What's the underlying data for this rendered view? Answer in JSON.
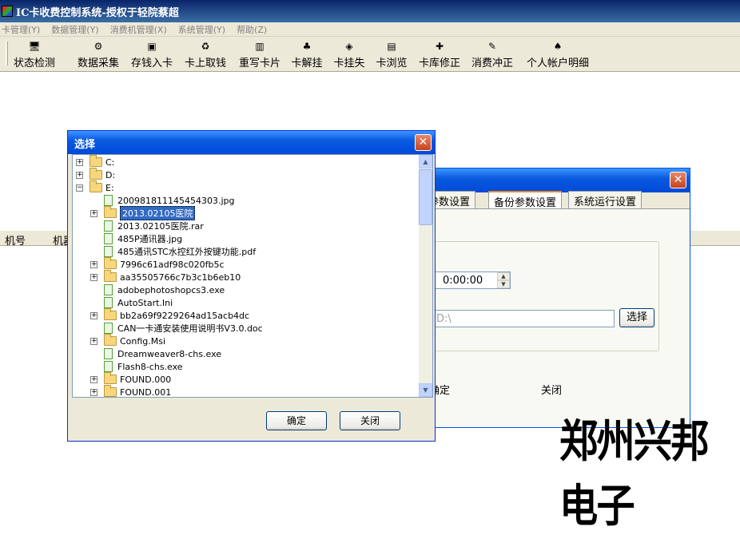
{
  "app": {
    "title": "IC卡收费控制系统-授权于轻院蔡超"
  },
  "menu": [
    {
      "label": "卡管理(Y)"
    },
    {
      "label": "数据管理(Y)"
    },
    {
      "label": "消费机管理(X)"
    },
    {
      "label": "系统管理(Y)"
    },
    {
      "label": "帮助(Z)"
    }
  ],
  "toolbar": {
    "buttons": [
      {
        "label": "状态检测",
        "icon": "status-monitor-icon",
        "glyph": "🖥"
      },
      {
        "label": "数据采集",
        "icon": "data-collect-icon",
        "glyph": "⚙"
      },
      {
        "label": "存钱入卡",
        "icon": "deposit-icon",
        "glyph": "▣"
      },
      {
        "label": "卡上取钱",
        "icon": "withdraw-icon",
        "glyph": "♻"
      },
      {
        "label": "重写卡片",
        "icon": "rewrite-card-icon",
        "glyph": "▥"
      },
      {
        "label": "卡解挂",
        "icon": "card-unlock-icon",
        "glyph": "♣"
      },
      {
        "label": "卡挂失",
        "icon": "card-lost-icon",
        "glyph": "◈"
      },
      {
        "label": "卡浏览",
        "icon": "card-browse-icon",
        "glyph": "▤"
      },
      {
        "label": "卡库修正",
        "icon": "card-db-fix-icon",
        "glyph": "✚"
      },
      {
        "label": "消费冲正",
        "icon": "consume-reverse-icon",
        "glyph": "✎"
      },
      {
        "label": "个人帐户明细",
        "icon": "personal-account-icon",
        "glyph": "♠"
      }
    ]
  },
  "table": {
    "columns": [
      "机号",
      "机器"
    ]
  },
  "settings": {
    "tabs": [
      "参数设置",
      "备份参数设置",
      "系统运行设置"
    ],
    "time_value": "0:00:00",
    "path_value": "D:\\",
    "choose_label": "选择",
    "ok_label": "确定",
    "close_label": "关闭"
  },
  "dialog": {
    "title": "选择",
    "close_glyph": "✕",
    "ok_label": "确定",
    "cancel_label": "关闭",
    "tree": [
      {
        "label": "C:",
        "kind": "folder",
        "level": 0,
        "expander": "+"
      },
      {
        "label": "D:",
        "kind": "folder",
        "level": 0,
        "expander": "+"
      },
      {
        "label": "E:",
        "kind": "folder",
        "level": 0,
        "expander": "−"
      },
      {
        "label": "200981811145454303.jpg",
        "kind": "file",
        "level": 1,
        "expander": ""
      },
      {
        "label": "2013.02105医院",
        "kind": "folder",
        "level": 1,
        "expander": "+",
        "selected": true
      },
      {
        "label": "2013.02105医院.rar",
        "kind": "file",
        "level": 1,
        "expander": ""
      },
      {
        "label": "485P通讯器.jpg",
        "kind": "file",
        "level": 1,
        "expander": ""
      },
      {
        "label": "485通讯STC水控红外按键功能.pdf",
        "kind": "file",
        "level": 1,
        "expander": ""
      },
      {
        "label": "7996c61adf98c020fb5c",
        "kind": "folder",
        "level": 1,
        "expander": "+"
      },
      {
        "label": "aa35505766c7b3c1b6eb10",
        "kind": "folder",
        "level": 1,
        "expander": "+"
      },
      {
        "label": "adobephotoshopcs3.exe",
        "kind": "file",
        "level": 1,
        "expander": ""
      },
      {
        "label": "AutoStart.Ini",
        "kind": "file",
        "level": 1,
        "expander": ""
      },
      {
        "label": "bb2a69f9229264ad15acb4dc",
        "kind": "folder",
        "level": 1,
        "expander": "+"
      },
      {
        "label": "CAN一卡通安装使用说明书V3.0.doc",
        "kind": "file",
        "level": 1,
        "expander": ""
      },
      {
        "label": "Config.Msi",
        "kind": "folder",
        "level": 1,
        "expander": "+"
      },
      {
        "label": "Dreamweaver8-chs.exe",
        "kind": "file",
        "level": 1,
        "expander": ""
      },
      {
        "label": "Flash8-chs.exe",
        "kind": "file",
        "level": 1,
        "expander": ""
      },
      {
        "label": "FOUND.000",
        "kind": "folder",
        "level": 1,
        "expander": "+"
      },
      {
        "label": "FOUND.001",
        "kind": "folder",
        "level": 1,
        "expander": "+"
      }
    ]
  },
  "watermark": "郑州兴邦电子"
}
